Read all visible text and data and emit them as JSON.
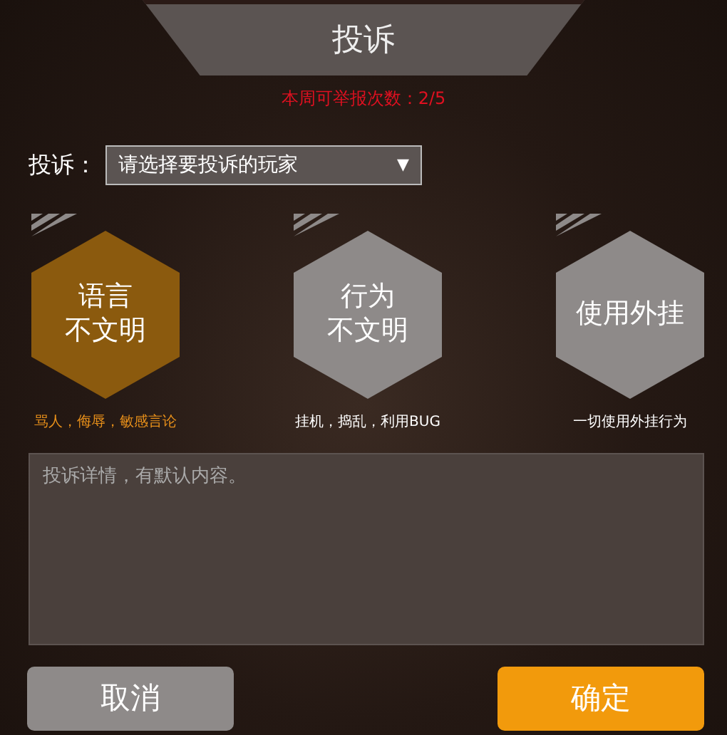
{
  "dialog": {
    "title": "投诉",
    "weekly_count": "本周可举报次数：2/5"
  },
  "player_select": {
    "label": "投诉：",
    "placeholder": "请选择要投诉的玩家",
    "caret": "▼"
  },
  "categories": [
    {
      "label_lines": [
        "语言",
        "不文明"
      ],
      "caption": "骂人，侮辱，敏感言论",
      "selected": true
    },
    {
      "label_lines": [
        "行为",
        "不文明"
      ],
      "caption": "挂机，捣乱，利用BUG",
      "selected": false
    },
    {
      "label_lines": [
        "使用外挂"
      ],
      "caption": "一切使用外挂行为",
      "selected": false
    }
  ],
  "details": {
    "placeholder": "投诉详情，有默认内容。"
  },
  "buttons": [
    {
      "label": "取消",
      "kind": "cancel"
    },
    {
      "label": "确定",
      "kind": "confirm"
    }
  ]
}
